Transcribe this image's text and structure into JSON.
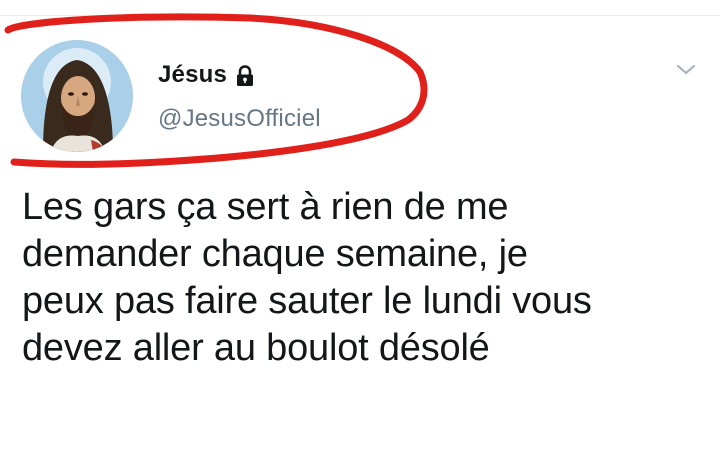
{
  "tweet": {
    "display_name": "Jésus",
    "handle": "@JesusOfficiel",
    "protected_icon": "lock-icon",
    "menu_icon": "chevron-down-icon",
    "avatar_icon": "jesus-portrait",
    "text_lines": [
      "Les gars ça sert à rien de me",
      "demander chaque semaine, je",
      "peux pas faire sauter le lundi vous",
      "devez aller au boulot désolé"
    ]
  },
  "colors": {
    "name_text": "#14171a",
    "handle_text": "#657786",
    "annotation_red": "#e0201b",
    "avatar_background": "#a9cfe9"
  }
}
